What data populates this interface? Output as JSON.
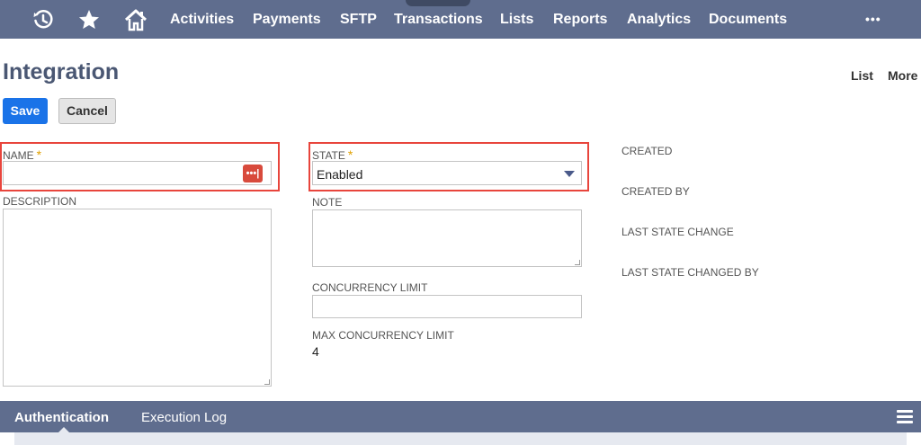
{
  "nav": {
    "icons": [
      "recent-history-icon",
      "star-icon",
      "home-icon"
    ],
    "items": [
      "Activities",
      "Payments",
      "SFTP",
      "Transactions",
      "Lists",
      "Reports",
      "Analytics",
      "Documents"
    ],
    "more": "•••"
  },
  "page": {
    "title": "Integration",
    "links": {
      "list": "List",
      "more": "More"
    }
  },
  "buttons": {
    "save": "Save",
    "cancel": "Cancel"
  },
  "form": {
    "name": {
      "label": "NAME",
      "required": "*",
      "value": ""
    },
    "description": {
      "label": "DESCRIPTION",
      "value": ""
    },
    "state": {
      "label": "STATE",
      "required": "*",
      "value": "Enabled"
    },
    "note": {
      "label": "NOTE",
      "value": ""
    },
    "concurrency_limit": {
      "label": "CONCURRENCY LIMIT",
      "value": ""
    },
    "max_concurrency_limit": {
      "label": "MAX CONCURRENCY LIMIT",
      "value": "4"
    },
    "created": {
      "label": "CREATED"
    },
    "created_by": {
      "label": "CREATED BY"
    },
    "last_state_change": {
      "label": "LAST STATE CHANGE"
    },
    "last_state_changed_by": {
      "label": "LAST STATE CHANGED BY"
    }
  },
  "subtabs": {
    "authentication": "Authentication",
    "execution_log": "Execution Log"
  },
  "colors": {
    "nav_bg": "#5f6d8e",
    "primary": "#1a73e8",
    "highlight": "#e8453c",
    "required": "#e0a000"
  }
}
